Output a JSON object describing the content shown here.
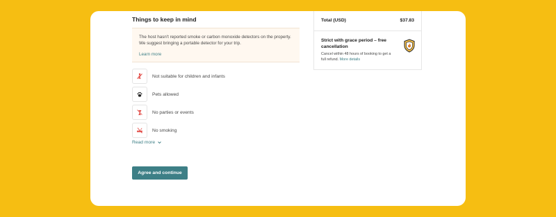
{
  "things": {
    "title": "Things to keep in mind",
    "notice": {
      "text": "The host hasn't reported smoke or carbon monoxide detectors on the property. We suggest bringing a portable detector for your trip.",
      "link": "Learn more"
    },
    "rules": [
      {
        "label": "Not suitable for children and infants",
        "icon": "no-children-icon"
      },
      {
        "label": "Pets allowed",
        "icon": "paw-icon"
      },
      {
        "label": "No parties or events",
        "icon": "no-parties-icon"
      },
      {
        "label": "No smoking",
        "icon": "no-smoking-icon"
      }
    ],
    "read_more": "Read more",
    "agree_button": "Agree and continue"
  },
  "summary": {
    "total_label": "Total (USD)",
    "total_value": "$37.83",
    "policy_title": "Strict with grace period – free cancellation",
    "policy_desc": "Cancel within 48 hours of booking to get a full refund.",
    "policy_link": "More details",
    "policy_icon": "shield-icon"
  },
  "colors": {
    "background": "#F6BE12",
    "accent": "#3D7F86",
    "icon_red": "#E0403B"
  }
}
